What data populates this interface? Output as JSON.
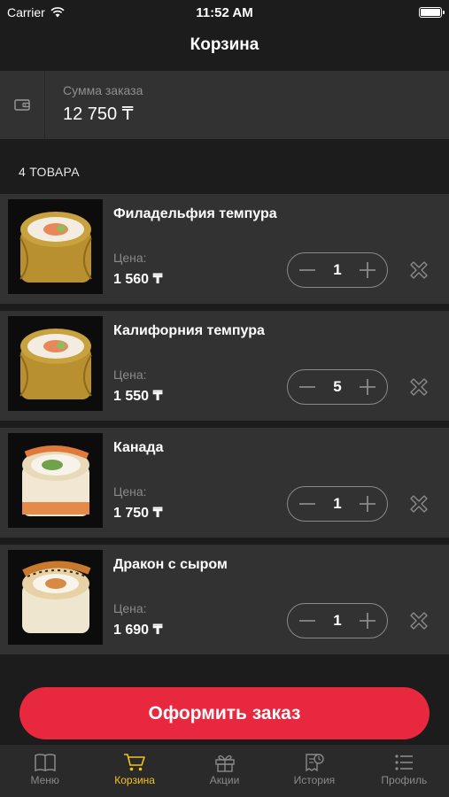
{
  "status_bar": {
    "carrier": "Carrier",
    "time": "11:52 AM"
  },
  "nav": {
    "title": "Корзина"
  },
  "summary": {
    "icon": "wallet-icon",
    "label": "Сумма заказа",
    "value": "12 750 ₸"
  },
  "items_count_label": "4 ТОВАРА",
  "cart_items": [
    {
      "name": "Филадельфия темпура",
      "price_label": "Цена:",
      "price": "1 560 ₸",
      "quantity": "1",
      "variant": "tempura"
    },
    {
      "name": "Калифорния темпура",
      "price_label": "Цена:",
      "price": "1 550 ₸",
      "quantity": "5",
      "variant": "tempura"
    },
    {
      "name": "Канада",
      "price_label": "Цена:",
      "price": "1 750 ₸",
      "quantity": "1",
      "variant": "canada"
    },
    {
      "name": "Дракон с сыром",
      "price_label": "Цена:",
      "price": "1 690 ₸",
      "quantity": "1",
      "variant": "dragon"
    }
  ],
  "checkout_label": "Оформить заказ",
  "tabs": [
    {
      "label": "Меню",
      "icon": "book-icon",
      "active": false
    },
    {
      "label": "Корзина",
      "icon": "cart-icon",
      "active": true
    },
    {
      "label": "Акции",
      "icon": "gift-icon",
      "active": false
    },
    {
      "label": "История",
      "icon": "history-icon",
      "active": false
    },
    {
      "label": "Профиль",
      "icon": "list-icon",
      "active": false
    }
  ],
  "colors": {
    "accent": "#e8283e",
    "active_tab": "#f5c21a",
    "background": "#1c1c1c",
    "card": "#323232"
  }
}
